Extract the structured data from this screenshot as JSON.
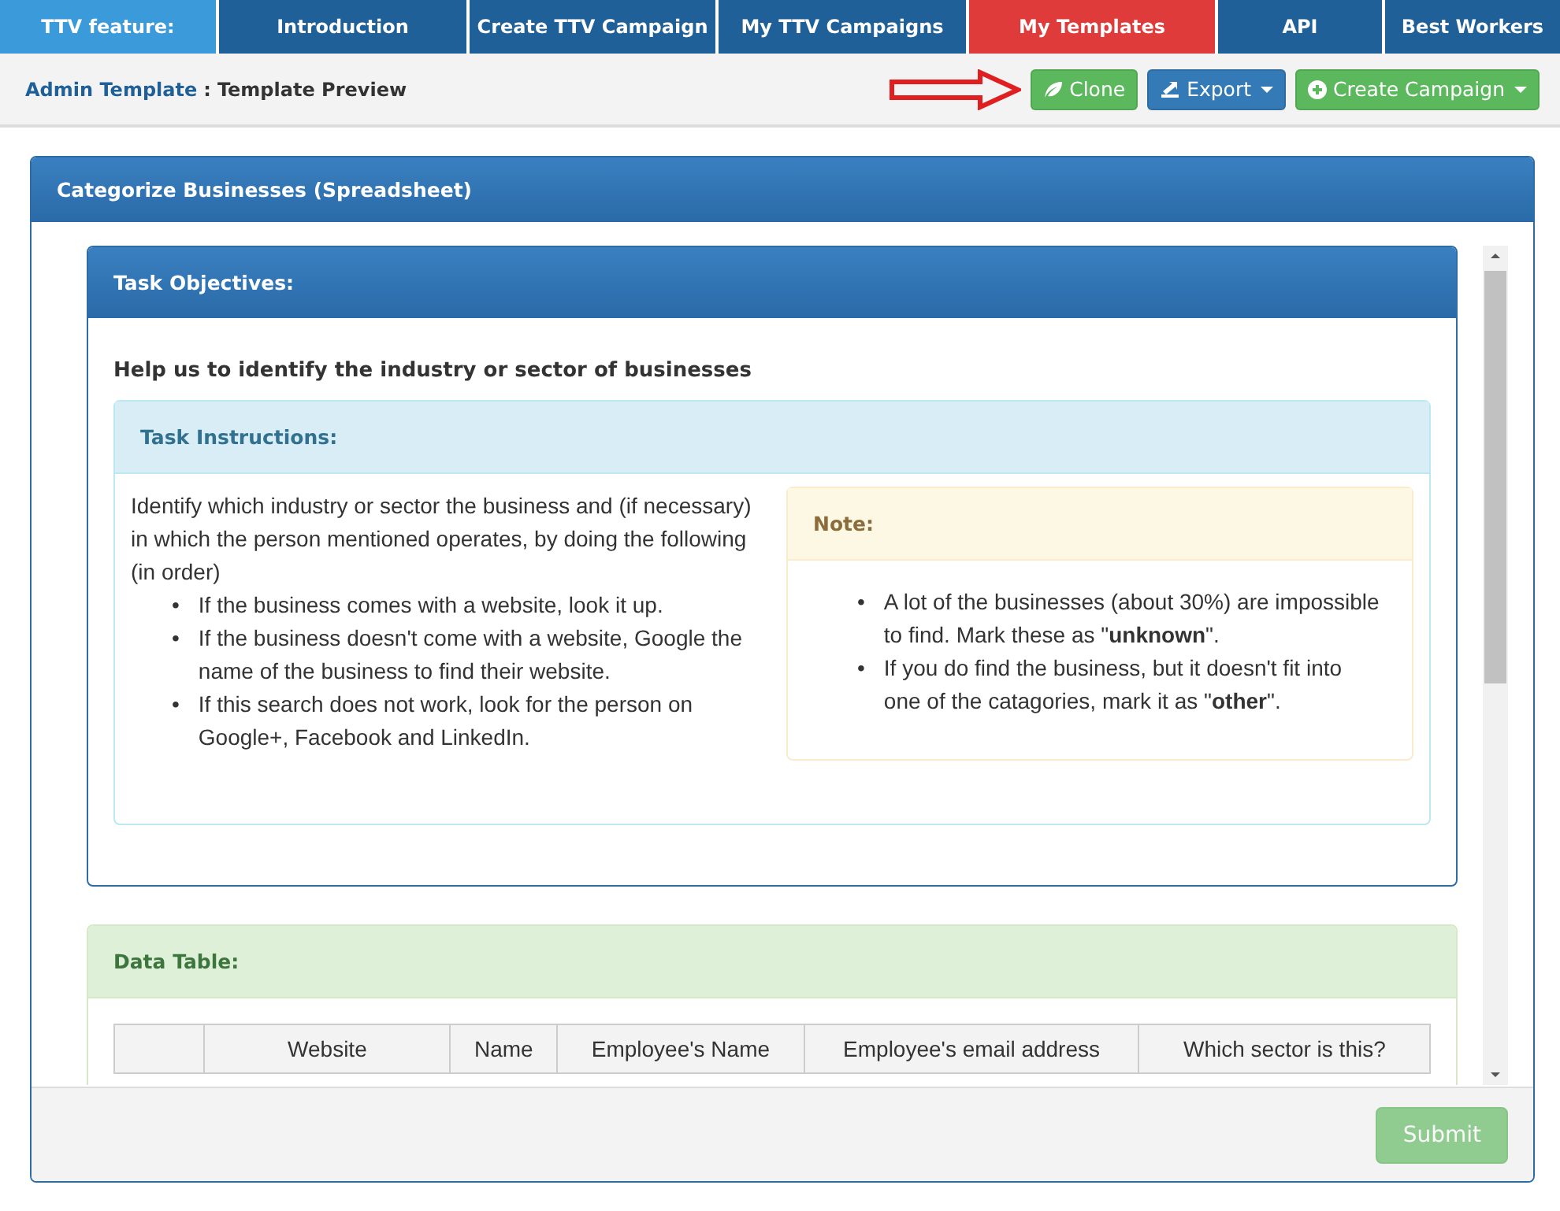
{
  "nav": {
    "label": "TTV feature:",
    "tabs": [
      {
        "label": "Introduction",
        "selected": false
      },
      {
        "label": "Create TTV Campaign",
        "selected": false
      },
      {
        "label": "My TTV Campaigns",
        "selected": false
      },
      {
        "label": "My Templates",
        "selected": true
      },
      {
        "label": "API",
        "selected": false
      },
      {
        "label": "Best Workers",
        "selected": false
      }
    ]
  },
  "breadcrumb": {
    "link": "Admin Template",
    "separator": ":",
    "current": "Template Preview"
  },
  "actions": [
    {
      "label": "Clone",
      "kind": "clone",
      "dropdown": false
    },
    {
      "label": "Export",
      "kind": "export",
      "dropdown": true
    },
    {
      "label": "Create Campaign",
      "kind": "create",
      "dropdown": true
    }
  ],
  "panel": {
    "title": "Categorize Businesses (Spreadsheet)",
    "objectives": {
      "title": "Task Objectives:",
      "summary": "Help us to identify the industry or sector of businesses",
      "instructions": {
        "title": "Task Instructions:",
        "intro": "Identify which industry or sector the business and (if necessary) in which the person mentioned operates, by doing the following (in order)",
        "steps": [
          {
            "marker": "•",
            "text": "If the business comes with a website, look it up."
          },
          {
            "marker": "•",
            "text": "If the business doesn't come with a website, Google the name of the business to find their website."
          },
          {
            "marker": "•",
            "text": "If this search does not work, look for the person on Google+, Facebook and LinkedIn."
          }
        ],
        "note": {
          "title": "Note:",
          "items": [
            {
              "marker": "•",
              "text": "A lot of the businesses (about 30%) are impossible to find. Mark these as \"**unknown**\"."
            },
            {
              "marker": "•",
              "text": "If you do find the business, but it doesn't fit into one of the catagories, mark it as \"**other**\"."
            }
          ]
        }
      }
    },
    "data_table": {
      "title": "Data Table:",
      "columns": [
        "",
        "Website",
        "Name",
        "Employee's Name",
        "Employee's email address",
        "Which sector is this?"
      ]
    },
    "submit": {
      "label": "Submit",
      "disabled": true
    }
  }
}
